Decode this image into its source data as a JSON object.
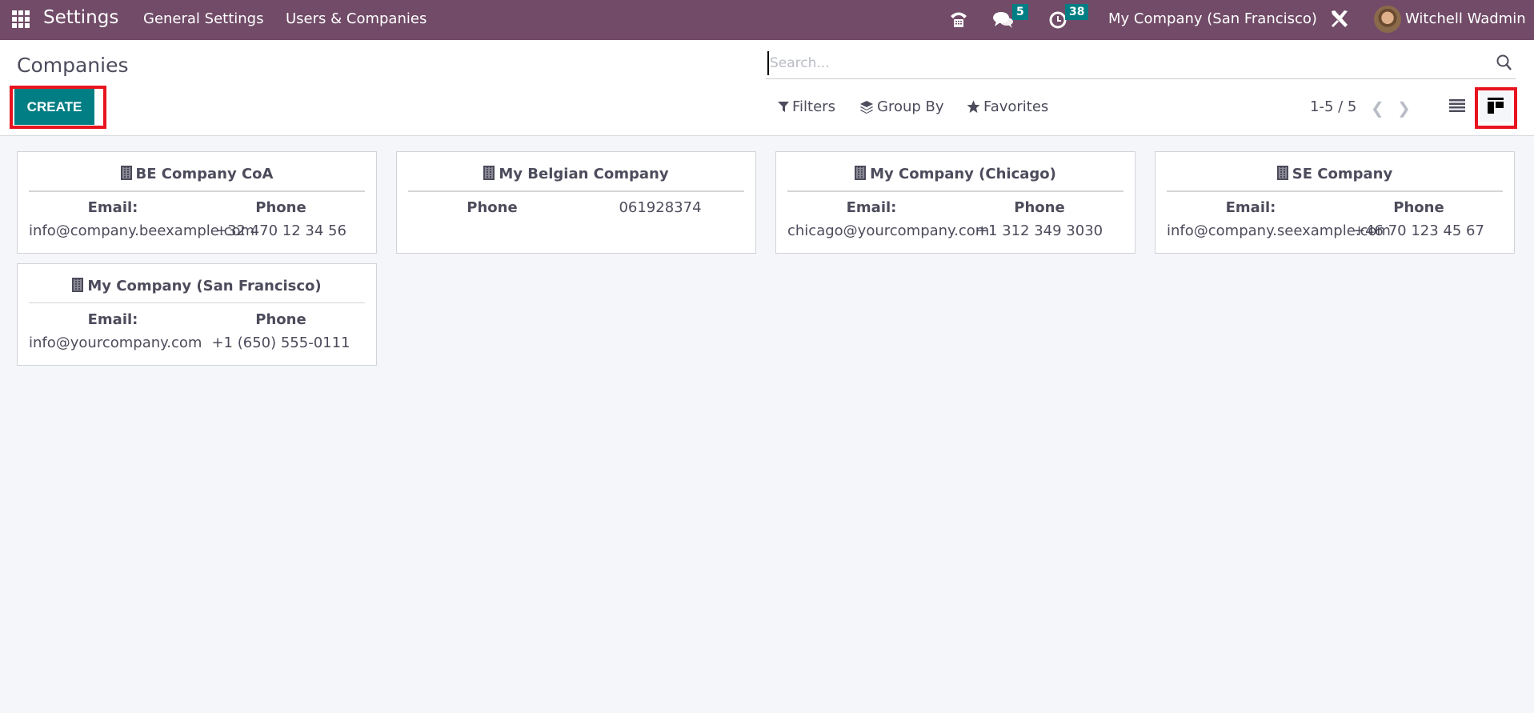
{
  "navbar": {
    "app_name": "Settings",
    "menu": [
      "General Settings",
      "Users & Companies"
    ],
    "icons": [
      "apps-icon",
      "phone-icon",
      "chat-icon",
      "clock-icon",
      "debug-tools-icon"
    ],
    "messages_count": "5",
    "activities_count": "38",
    "current_company": "My Company (San Francisco)",
    "user_name": "Witchell Wadmin"
  },
  "control_panel": {
    "title": "Companies",
    "create_label": "CREATE",
    "search_placeholder": "Search...",
    "search_value": "",
    "filters_label": "Filters",
    "group_by_label": "Group By",
    "favorites_label": "Favorites",
    "pager": "1-5 / 5",
    "views": [
      "list",
      "kanban"
    ],
    "active_view": "kanban"
  },
  "companies": [
    {
      "name": "BE Company CoA",
      "label1": "Email:",
      "value1": "info@company.beexample.com",
      "label2": "Phone",
      "value2": "+32 470 12 34 56"
    },
    {
      "name": "My Belgian Company",
      "label1": "Phone",
      "value1": "",
      "label2": "061928374",
      "value2": ""
    },
    {
      "name": "My Company (Chicago)",
      "label1": "Email:",
      "value1": "chicago@yourcompany.com",
      "label2": "Phone",
      "value2": "+1 312 349 3030"
    },
    {
      "name": "SE Company",
      "label1": "Email:",
      "value1": "info@company.seexample.com",
      "label2": "Phone",
      "value2": "+46 70 123 45 67"
    },
    {
      "name": "My Company (San Francisco)",
      "label1": "Email:",
      "value1": "info@yourcompany.com",
      "label2": "Phone",
      "value2": "+1 (650) 555-0111"
    }
  ],
  "colors": {
    "navbar": "#714b67",
    "primary": "#017e84",
    "highlight": "#e8141f"
  }
}
